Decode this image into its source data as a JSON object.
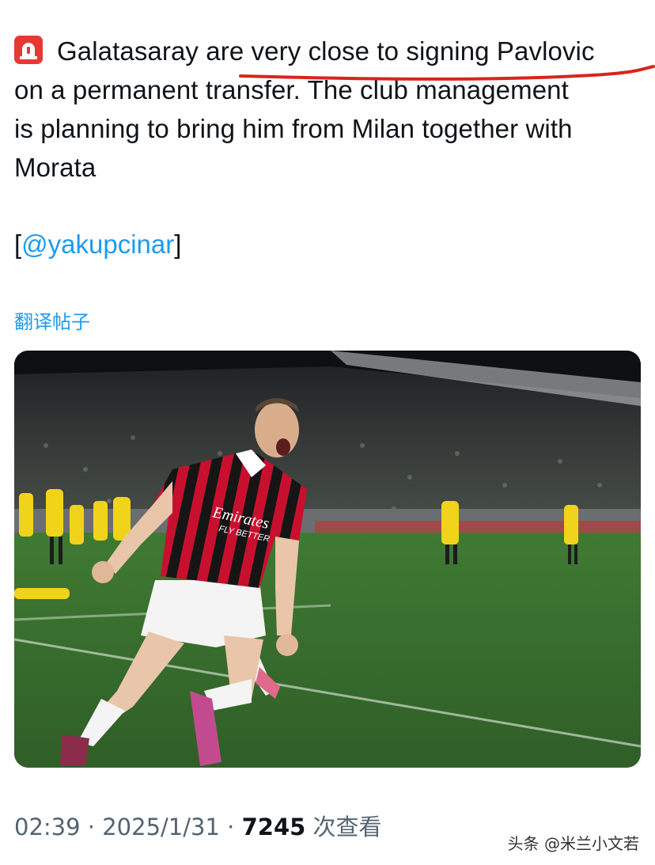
{
  "tweet": {
    "alert_icon": "rotating-light-icon",
    "lines": [
      "Galatasaray are very close to signing Pavlovic",
      "on a permanent transfer. The club management",
      "is planning to bring him from Milan together with",
      "Morata"
    ],
    "source_open": "[",
    "source_handle": "@yakupcinar",
    "source_close": "]",
    "translate_label": "翻译帖子"
  },
  "photo": {
    "kit_sponsor_line1": "Emirates",
    "kit_sponsor_line2": "FLY BETTER"
  },
  "meta": {
    "time": "02:39",
    "sep1": " · ",
    "date": "2025/1/31",
    "sep2": " · ",
    "views": "7245",
    "views_label": " 次查看"
  },
  "watermark": "头条 @米兰小文若",
  "colors": {
    "link": "#1d9bf0",
    "annotation": "#d7261c",
    "milan_red": "#c8102e",
    "opponent_yellow": "#f2d31b"
  }
}
